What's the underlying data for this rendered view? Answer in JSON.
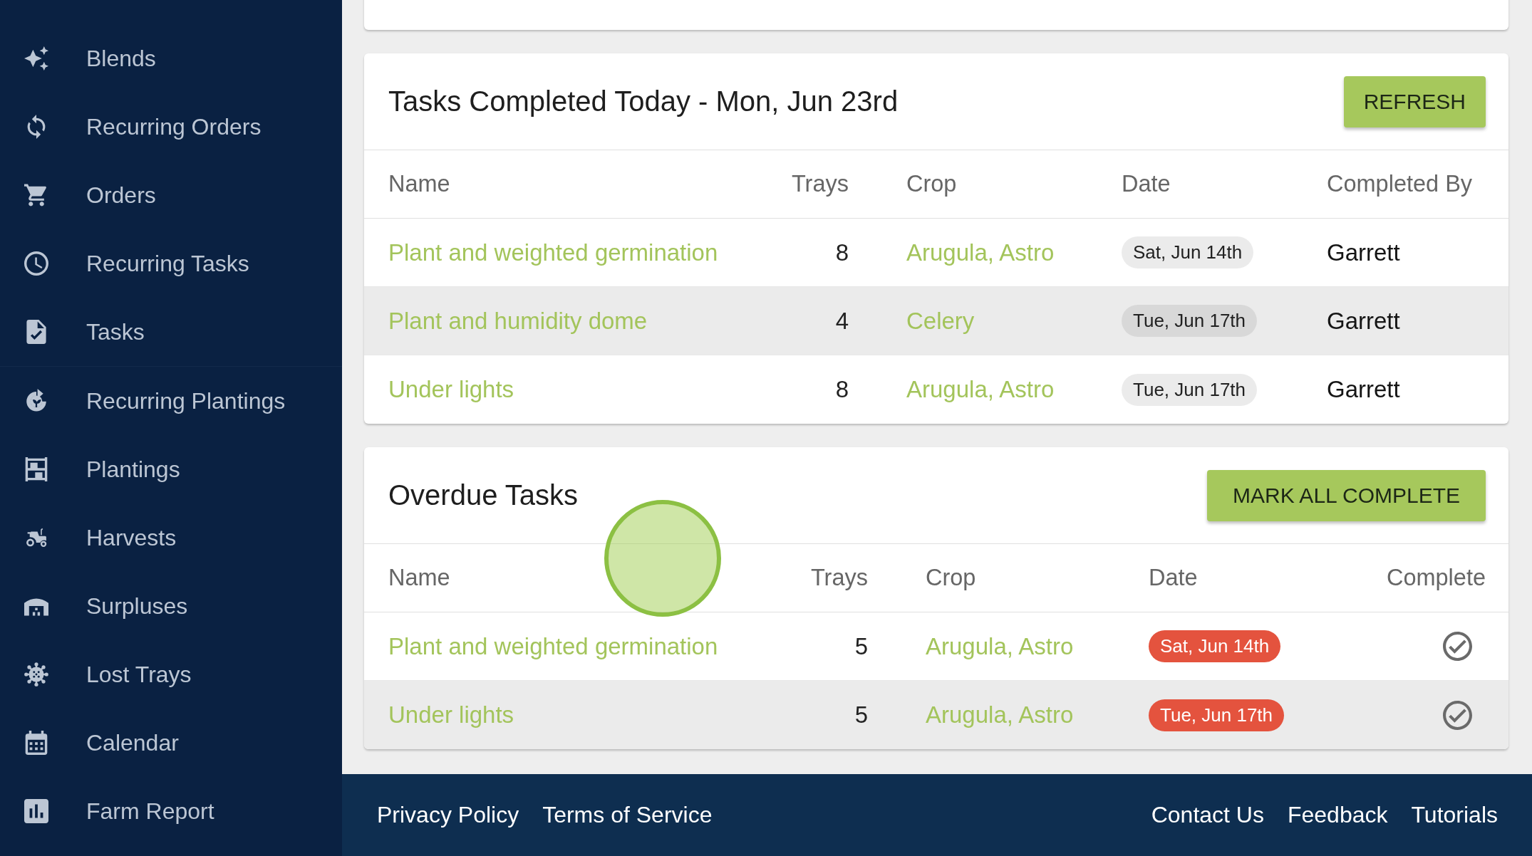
{
  "sidebar": {
    "groups": [
      {
        "items": [
          {
            "label": "Blends",
            "selected": false
          },
          {
            "label": "Recurring Orders",
            "selected": false
          },
          {
            "label": "Orders",
            "selected": false
          },
          {
            "label": "Recurring Tasks",
            "selected": false
          },
          {
            "label": "Tasks",
            "selected": false
          }
        ]
      },
      {
        "items": [
          {
            "label": "Recurring Plantings",
            "selected": false
          },
          {
            "label": "Plantings",
            "selected": false
          },
          {
            "label": "Harvests",
            "selected": false
          },
          {
            "label": "Surpluses",
            "selected": false
          },
          {
            "label": "Lost Trays",
            "selected": false
          },
          {
            "label": "Calendar",
            "selected": false
          },
          {
            "label": "Farm Report",
            "selected": false
          }
        ]
      }
    ]
  },
  "completed_card": {
    "title": "Tasks Completed Today - Mon, Jun 23rd",
    "button": "REFRESH",
    "columns": [
      "Name",
      "Trays",
      "Crop",
      "Date",
      "Completed By"
    ],
    "rows": [
      {
        "name": "Plant and weighted germination",
        "trays": "8",
        "crop": "Arugula, Astro",
        "date": "Sat, Jun 14th",
        "overdue": false,
        "completed_by": "Garrett"
      },
      {
        "name": "Plant and humidity dome",
        "trays": "4",
        "crop": "Celery",
        "date": "Tue, Jun 17th",
        "overdue": false,
        "completed_by": "Garrett"
      },
      {
        "name": "Under lights",
        "trays": "8",
        "crop": "Arugula, Astro",
        "date": "Tue, Jun 17th",
        "overdue": false,
        "completed_by": "Garrett"
      }
    ]
  },
  "overdue_card": {
    "title": "Overdue Tasks",
    "button": "MARK ALL COMPLETE",
    "columns": [
      "Name",
      "Trays",
      "Crop",
      "Date",
      "Complete"
    ],
    "rows": [
      {
        "name": "Plant and weighted germination",
        "trays": "5",
        "crop": "Arugula, Astro",
        "date": "Sat, Jun 14th",
        "overdue": true
      },
      {
        "name": "Under lights",
        "trays": "5",
        "crop": "Arugula, Astro",
        "date": "Tue, Jun 17th",
        "overdue": true
      }
    ]
  },
  "footer": {
    "left_links": [
      "Privacy Policy",
      "Terms of Service"
    ],
    "right_links": [
      "Contact Us",
      "Feedback",
      "Tutorials"
    ]
  }
}
